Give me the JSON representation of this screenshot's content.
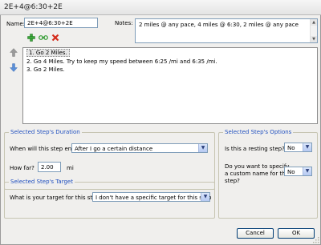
{
  "window": {
    "title": "2E+4@6:30+2E"
  },
  "form": {
    "name_label": "Name:",
    "name_value": "2E+4@6:30+2E",
    "notes_label": "Notes:",
    "notes_value": "2 miles @ any pace, 4 miles @ 6:30, 2 miles @ any pace"
  },
  "toolbar_icons": [
    "add-icon",
    "link-icon",
    "delete-icon"
  ],
  "move_icons": [
    "move-up-arrow-icon",
    "move-down-arrow-icon"
  ],
  "steps": [
    "1. Go 2 Miles.",
    "2. Go 4 Miles. Try to keep my speed between 6:25 /mi and 6:35 /mi.",
    "3. Go 2 Miles."
  ],
  "duration": {
    "legend": "Selected Step's Duration",
    "end_question": "When will this step end?",
    "end_value": "After I go a certain distance",
    "how_far_label": "How far?",
    "how_far_value": "2.00",
    "unit": "mi"
  },
  "target": {
    "legend": "Selected Step's Target",
    "question": "What is your target for this step?",
    "value": "I don't have a specific target for this step"
  },
  "options": {
    "legend": "Selected Step's Options",
    "resting_question": "Is this a resting step?",
    "resting_value": "No",
    "custom_name_line1": "Do you want to specify",
    "custom_name_line2": "a custom name for this",
    "custom_name_line3": "step?",
    "custom_name_value": "No"
  },
  "buttons": {
    "cancel": "Cancel",
    "ok": "OK"
  },
  "colors": {
    "legend": "#1f4fbf",
    "accent_add": "#2f9a2f",
    "accent_delete": "#d42a1a",
    "arrow_blue": "#5a8fd8"
  }
}
